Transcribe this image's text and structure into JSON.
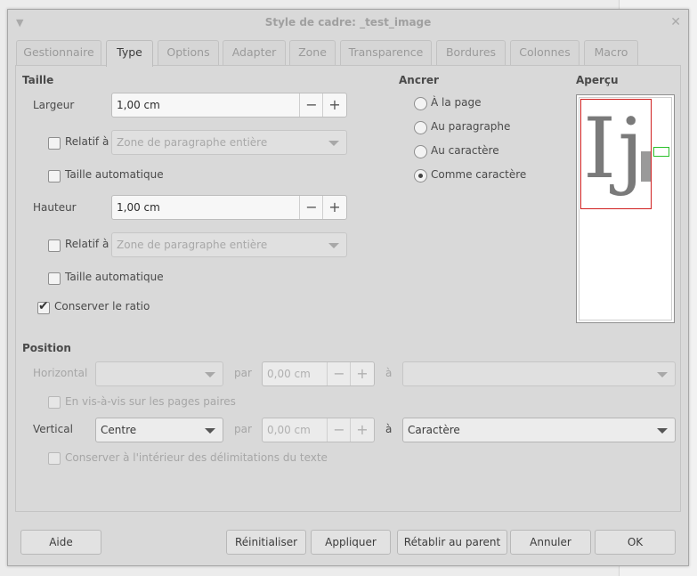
{
  "window": {
    "title": "Style de cadre: _test_image"
  },
  "tabs": [
    {
      "label": "Gestionnaire"
    },
    {
      "label": "Type"
    },
    {
      "label": "Options"
    },
    {
      "label": "Adapter"
    },
    {
      "label": "Zone"
    },
    {
      "label": "Transparence"
    },
    {
      "label": "Bordures"
    },
    {
      "label": "Colonnes"
    },
    {
      "label": "Macro"
    }
  ],
  "size": {
    "heading": "Taille",
    "width_label": "Largeur",
    "width_value": "1,00 cm",
    "relative_label": "Relatif à",
    "relative_value": "Zone de paragraphe entière",
    "auto_size_label": "Taille automatique",
    "height_label": "Hauteur",
    "height_value": "1,00 cm",
    "keep_ratio_label": "Conserver le ratio"
  },
  "anchor": {
    "heading": "Ancrer",
    "options": [
      {
        "label": "À la page"
      },
      {
        "label": "Au paragraphe"
      },
      {
        "label": "Au caractère"
      },
      {
        "label": "Comme caractère"
      }
    ]
  },
  "preview": {
    "heading": "Aperçu",
    "glyphs": "Ij"
  },
  "position": {
    "heading": "Position",
    "horizontal_label": "Horizontal",
    "par_label": "par",
    "a_label": "à",
    "spin_value": "0,00 cm",
    "mirror_label": "En vis-à-vis sur les pages paires",
    "vertical_label": "Vertical",
    "vertical_value": "Centre",
    "vertical_to_value": "Caractère",
    "keep_inside_label": "Conserver à l'intérieur des délimitations du texte"
  },
  "spin_icons": {
    "minus": "−",
    "plus": "+"
  },
  "buttons": {
    "help": "Aide",
    "reset": "Réinitialiser",
    "apply": "Appliquer",
    "restore_parent": "Rétablir au parent",
    "cancel": "Annuler",
    "ok": "OK"
  }
}
